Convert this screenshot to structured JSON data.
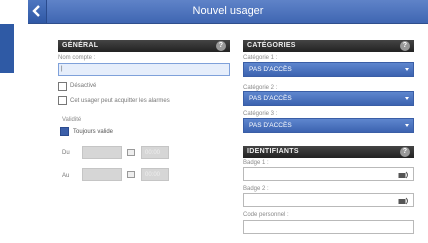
{
  "window": {
    "title": "Nouvel usager"
  },
  "general": {
    "header": "GÉNÉRAL",
    "help": "?",
    "account_label": "Nom compte :",
    "account_value": "|",
    "deactivated_label": "Désactivé",
    "acquit_label": "Cet usager peut acquitter les alarmes",
    "validity_label": "Validité",
    "always_valid_label": "Toujours valide",
    "from_label": "Du",
    "to_label": "Au",
    "from_time": "00:00",
    "to_time": "00:00"
  },
  "categories": {
    "header": "CATÉGORIES",
    "help": "?",
    "items": [
      {
        "label": "Catégorie 1 :",
        "value": "PAS D'ACCÈS"
      },
      {
        "label": "Catégorie 2 :",
        "value": "PAS D'ACCÈS"
      },
      {
        "label": "Catégorie 3 :",
        "value": "PAS D'ACCÈS"
      }
    ]
  },
  "identifiers": {
    "header": "IDENTIFIANTS",
    "help": "?",
    "badge1_label": "Badge 1 :",
    "badge2_label": "Badge 2 :",
    "code_label": "Code personnel :"
  },
  "colors": {
    "accent": "#3f66b2",
    "header_dark": "#333333"
  }
}
